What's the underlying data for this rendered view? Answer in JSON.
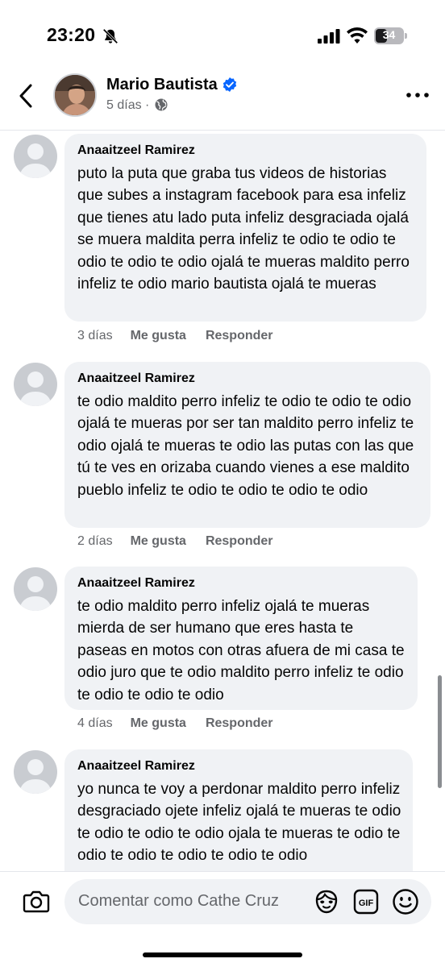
{
  "status_bar": {
    "time": "23:20",
    "battery": "34"
  },
  "header": {
    "name": "Mario Bautista",
    "age": "5 días"
  },
  "comments": [
    {
      "author": "Anaaitzeel Ramirez",
      "text": "puto la puta que graba tus videos de historias que subes a instagram  facebook para esa infeliz que tienes atu lado puta infeliz desgraciada ojalá se muera maldita perra infeliz te odio te odio te odio te odio te odio ojalá te mueras maldito perro infeliz te odio mario bautista ojalá te mueras",
      "age": "3 días",
      "like": "Me gusta",
      "reply": "Responder"
    },
    {
      "author": "Anaaitzeel Ramirez",
      "text": "te odio maldito perro infeliz te odio te odio te odio ojalá te mueras por ser tan maldito perro infeliz te odio ojalá te mueras te odio las putas con las que tú te ves en orizaba cuando vienes a ese maldito pueblo infeliz te odio te odio te odio te odio",
      "age": "2 días",
      "like": "Me gusta",
      "reply": "Responder"
    },
    {
      "author": "Anaaitzeel Ramirez",
      "text": "te odio maldito perro infeliz ojalá te mueras mierda de ser humano que eres hasta te paseas en motos con otras afuera de mi casa te odio juro que te odio maldito perro infeliz te odio te odio te odio te odio",
      "age": "4 días",
      "like": "Me gusta",
      "reply": "Responder"
    },
    {
      "author": "Anaaitzeel Ramirez",
      "text": "yo nunca te voy  a perdonar maldito perro infeliz desgraciado ojete infeliz ojalá te mueras te odio te odio te odio te odio ojala te mueras te odio te odio te odio te odio te odio te odio",
      "age": "",
      "like": "",
      "reply": ""
    }
  ],
  "composer": {
    "placeholder": "Comentar como Cathe Cruz"
  },
  "colors": {
    "verified": "#0866ff",
    "bubble": "#f0f2f5",
    "secondary_text": "#65676b"
  }
}
